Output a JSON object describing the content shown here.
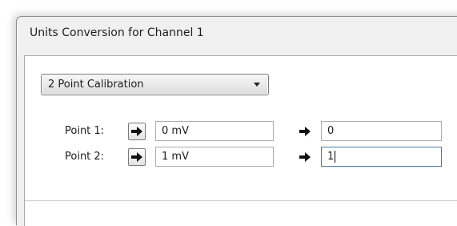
{
  "dialog": {
    "title": "Units Conversion for Channel 1"
  },
  "calibration_dropdown": {
    "selected": "2 Point Calibration",
    "icon": "chevron-down-icon"
  },
  "points": [
    {
      "label": "Point 1:",
      "input_value": "0 mV",
      "output_value": "0",
      "focused": false
    },
    {
      "label": "Point 2:",
      "input_value": "1 mV",
      "output_value": "1",
      "focused": true
    }
  ],
  "icons": {
    "apply_button": "arrow-right-icon",
    "mapping": "arrow-right-icon"
  }
}
